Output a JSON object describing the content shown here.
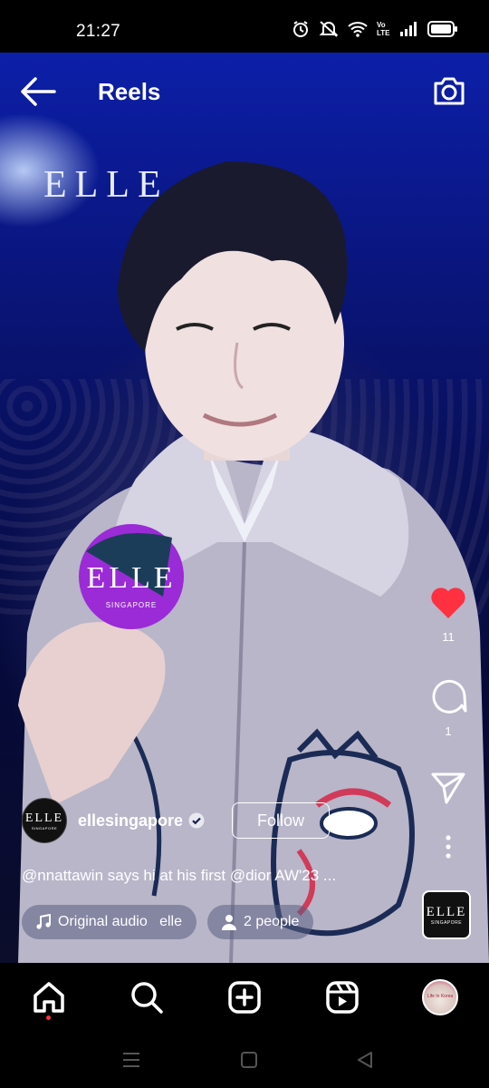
{
  "status_bar": {
    "time": "21:27",
    "icons": [
      "alarm-icon",
      "mute-icon",
      "wifi-icon",
      "volte-icon",
      "signal-icon",
      "battery-icon"
    ],
    "volte_label": "Vo LTE"
  },
  "header": {
    "title": "Reels",
    "back_icon": "arrow-left-icon",
    "camera_icon": "camera-icon"
  },
  "video": {
    "backdrop_text": "ELLE",
    "badge_text": "ELLE",
    "badge_subtext": "SINGAPORE"
  },
  "actions": {
    "like_count": "11",
    "comment_count": "1",
    "like_color": "#ff3040"
  },
  "post": {
    "avatar_logo": "ELLE",
    "avatar_subtext": "SINGAPORE",
    "username": "ellesingapore",
    "verified": true,
    "follow_label": "Follow",
    "caption": "@nnattawin says hi at his first @dior AW'23 ...",
    "audio_label": "Original audio   elle",
    "people_label": "2 people",
    "audio_thumb_logo": "ELLE",
    "audio_thumb_subtext": "SINGAPORE"
  },
  "bottom_nav": {
    "items": [
      "home-icon",
      "search-icon",
      "create-icon",
      "reels-icon",
      "profile-avatar"
    ],
    "active": "home-icon",
    "profile_avatar_text": "Life In Korea"
  },
  "system_nav": {
    "items": [
      "recents-icon",
      "home-square-icon",
      "back-triangle-icon"
    ]
  }
}
